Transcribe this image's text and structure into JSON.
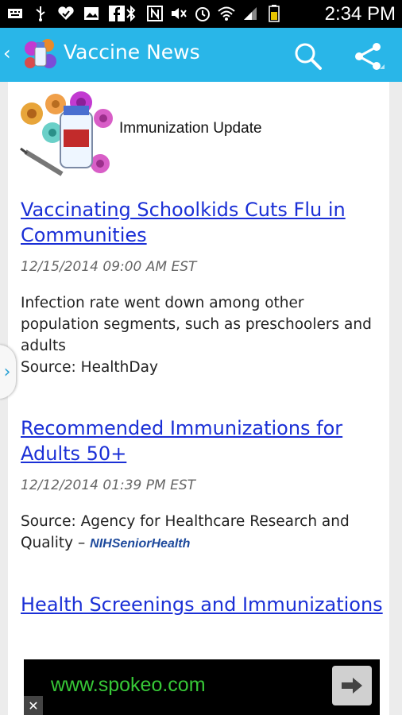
{
  "status_bar": {
    "time": "2:34 PM"
  },
  "app": {
    "title": "Vaccine News",
    "back_glyph": "‹"
  },
  "feed": {
    "header_title": "Immunization Update",
    "articles": [
      {
        "title": "Vaccinating Schoolkids Cuts Flu in Communities",
        "date": "12/15/2014 09:00 AM EST",
        "summary": "Infection rate went down among other population segments, such as preschoolers and adults",
        "source": "Source: HealthDay"
      },
      {
        "title": "Recommended Immunizations for Adults 50+",
        "date": "12/12/2014 01:39 PM EST",
        "source": "Source: Agency for Healthcare Research and Quality –",
        "source_logo": "NIHSeniorHealth"
      },
      {
        "title": "Health Screenings and Immunizations"
      }
    ]
  },
  "drawer_handle": {
    "glyph": "›"
  },
  "ad": {
    "url": "www.spokeo.com",
    "close": "✕"
  },
  "colors": {
    "appbar": "#29b6e8",
    "link": "#1a2fd6",
    "ad_text": "#37c837"
  }
}
